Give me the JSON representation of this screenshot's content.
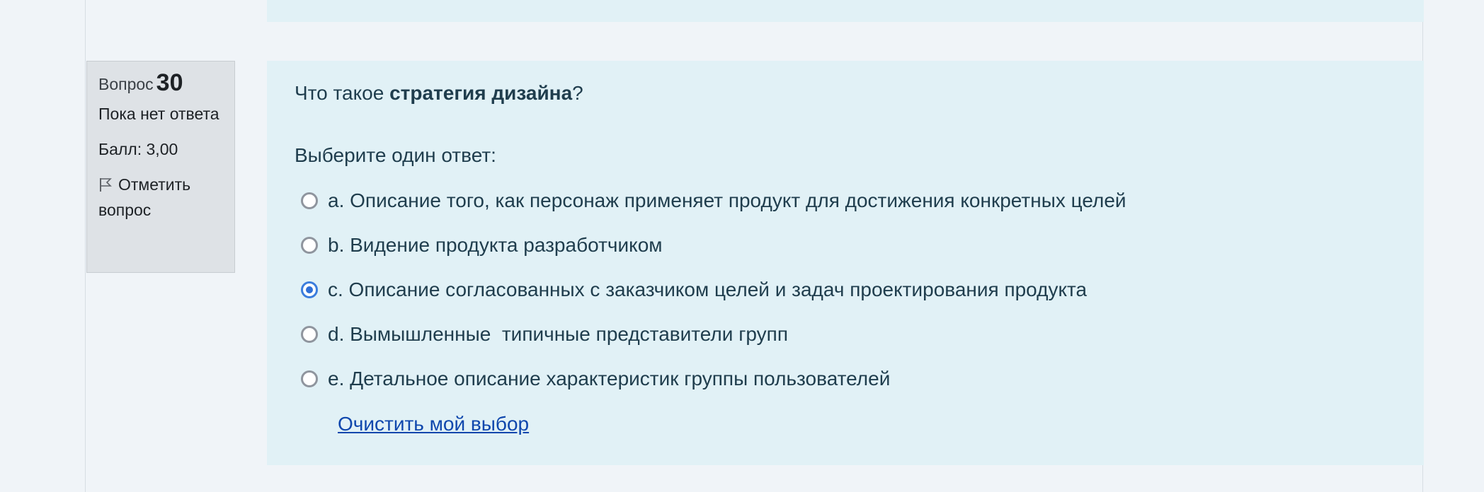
{
  "question": {
    "number_label": "Вопрос",
    "number": "30",
    "state": "Пока нет ответа",
    "grade": "Балл: 3,00",
    "flag_label": "Отметить вопрос",
    "text_prefix": "Что такое ",
    "text_bold": "стратегия дизайна",
    "text_suffix": "?",
    "prompt": "Выберите один ответ:",
    "answers": [
      {
        "label": "a. Описание того, как персонаж применяет продукт для достижения конкретных целей",
        "selected": false
      },
      {
        "label": "b. Видение продукта разработчиком",
        "selected": false
      },
      {
        "label": "c. Описание согласованных с заказчиком целей и задач проектирования продукта",
        "selected": true
      },
      {
        "label": "d. Вымышленные  типичные представители групп",
        "selected": false
      },
      {
        "label": "e. Детальное описание характеристик группы пользователей",
        "selected": false
      }
    ],
    "clear_label": "Очистить мой выбор"
  },
  "colors": {
    "content_bg": "#e1f1f6",
    "info_bg": "#dee2e6",
    "link": "#0f47ad",
    "radio_checked": "#2f6fd6"
  },
  "icons": {
    "flag": "flag-icon"
  }
}
